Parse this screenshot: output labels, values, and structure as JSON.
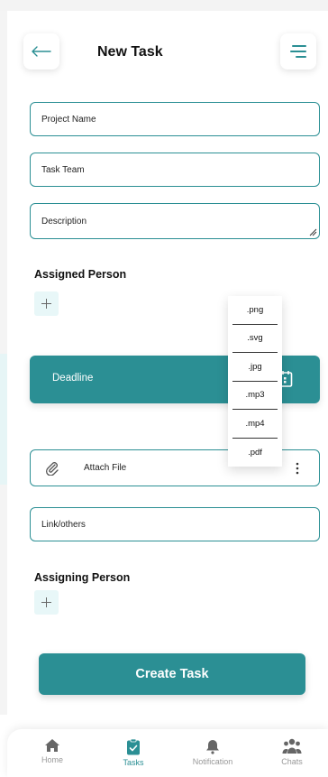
{
  "header": {
    "title": "New Task"
  },
  "fields": {
    "project_name": "Project Name",
    "task_team": "Task Team",
    "description": "Description",
    "link_others": "Link/others"
  },
  "assigned": {
    "label": "Assigned Person"
  },
  "deadline": {
    "label": "Deadline"
  },
  "attach": {
    "label": "Attach File"
  },
  "file_types": [
    ".png",
    ".svg",
    ".jpg",
    ".mp3",
    ".mp4",
    ".pdf"
  ],
  "assigning": {
    "label": "Assigning Person"
  },
  "create_button": "Create Task",
  "nav": [
    {
      "label": "Home",
      "icon": "home-icon",
      "active": false
    },
    {
      "label": "Tasks",
      "icon": "tasks-icon",
      "active": true
    },
    {
      "label": "Notification",
      "icon": "bell-icon",
      "active": false
    },
    {
      "label": "Chats",
      "icon": "people-icon",
      "active": false
    }
  ],
  "colors": {
    "accent": "#2b8f94",
    "accent_light": "#e8f7f8",
    "inactive": "#999999"
  }
}
